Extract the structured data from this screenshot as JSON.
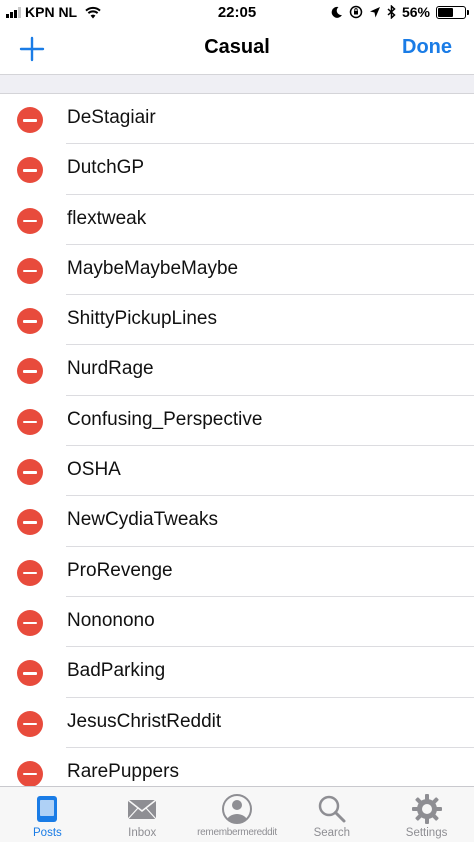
{
  "status_bar": {
    "carrier": "KPN NL",
    "time": "22:05",
    "battery_percent": "56%",
    "battery_level": 0.56
  },
  "nav": {
    "title": "Casual",
    "done_label": "Done"
  },
  "list": {
    "items": [
      {
        "label": "DeStagiair"
      },
      {
        "label": "DutchGP"
      },
      {
        "label": "flextweak"
      },
      {
        "label": "MaybeMaybeMaybe"
      },
      {
        "label": "ShittyPickupLines"
      },
      {
        "label": "NurdRage"
      },
      {
        "label": "Confusing_Perspective"
      },
      {
        "label": "OSHA"
      },
      {
        "label": "NewCydiaTweaks"
      },
      {
        "label": "ProRevenge"
      },
      {
        "label": "Nononono"
      },
      {
        "label": "BadParking"
      },
      {
        "label": "JesusChristReddit"
      },
      {
        "label": "RarePuppers"
      }
    ]
  },
  "tab_bar": {
    "tabs": [
      {
        "label": "Posts",
        "icon": "posts-icon",
        "active": true
      },
      {
        "label": "Inbox",
        "icon": "inbox-icon",
        "active": false
      },
      {
        "label": "remembermereddit",
        "icon": "profile-icon",
        "active": false
      },
      {
        "label": "Search",
        "icon": "search-icon",
        "active": false
      },
      {
        "label": "Settings",
        "icon": "settings-icon",
        "active": false
      }
    ]
  },
  "colors": {
    "accent": "#1a7ce6",
    "delete": "#e84b3c",
    "inactive_tab": "#8e8e93"
  }
}
